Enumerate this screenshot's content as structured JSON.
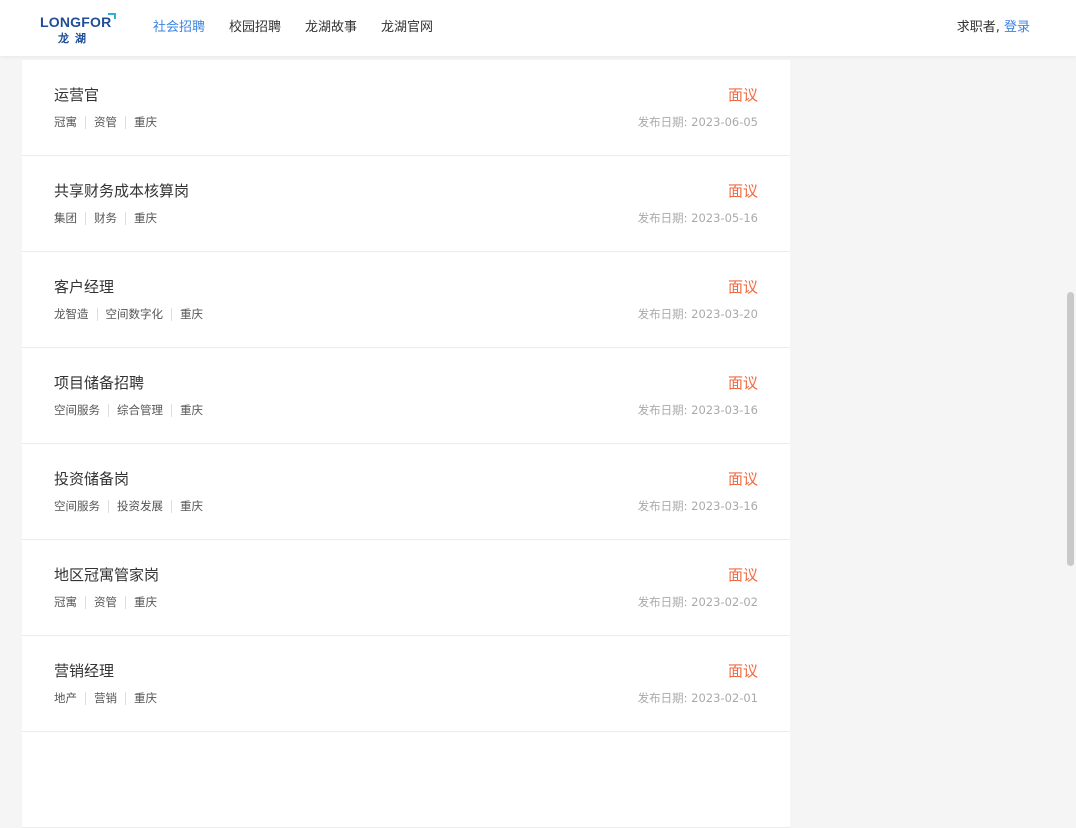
{
  "header": {
    "logo_en": "LONGFOR",
    "logo_cn": "龙湖",
    "nav": [
      {
        "label": "社会招聘",
        "active": true
      },
      {
        "label": "校园招聘",
        "active": false
      },
      {
        "label": "龙湖故事",
        "active": false
      },
      {
        "label": "龙湖官网",
        "active": false
      }
    ],
    "user_prefix": "求职者, ",
    "login_label": "登录"
  },
  "jobs": [
    {
      "title": "运营官",
      "tags": [
        "冠寓",
        "资管",
        "重庆"
      ],
      "salary": "面议",
      "date": "发布日期: 2023-06-05"
    },
    {
      "title": "共享财务成本核算岗",
      "tags": [
        "集团",
        "财务",
        "重庆"
      ],
      "salary": "面议",
      "date": "发布日期: 2023-05-16"
    },
    {
      "title": "客户经理",
      "tags": [
        "龙智造",
        "空间数字化",
        "重庆"
      ],
      "salary": "面议",
      "date": "发布日期: 2023-03-20"
    },
    {
      "title": "项目储备招聘",
      "tags": [
        "空间服务",
        "综合管理",
        "重庆"
      ],
      "salary": "面议",
      "date": "发布日期: 2023-03-16"
    },
    {
      "title": "投资储备岗",
      "tags": [
        "空间服务",
        "投资发展",
        "重庆"
      ],
      "salary": "面议",
      "date": "发布日期: 2023-03-16"
    },
    {
      "title": "地区冠寓管家岗",
      "tags": [
        "冠寓",
        "资管",
        "重庆"
      ],
      "salary": "面议",
      "date": "发布日期: 2023-02-02"
    },
    {
      "title": "营销经理",
      "tags": [
        "地产",
        "营销",
        "重庆"
      ],
      "salary": "面议",
      "date": "发布日期: 2023-02-01"
    },
    {
      "title": "",
      "tags": [],
      "salary": "",
      "date": ""
    }
  ],
  "colors": {
    "accent": "#3b84e0",
    "salary": "#f06a3f",
    "logo": "#1f4e96"
  }
}
